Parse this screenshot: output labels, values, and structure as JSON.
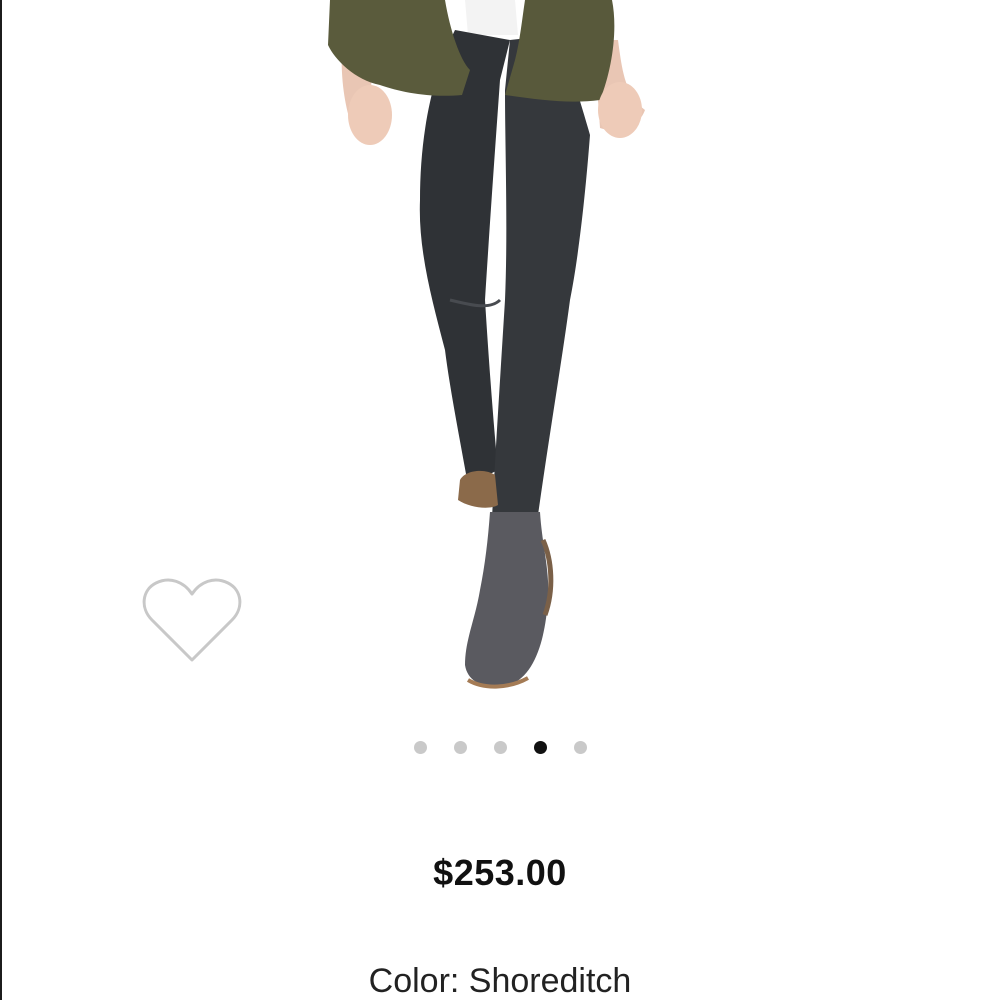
{
  "product": {
    "image_alt": "Model wearing dark coated skinny leggings, olive shirt and grey ankle boots",
    "price": "$253.00",
    "color_label": "Color:",
    "color_value": "Shoreditch"
  },
  "favorite": {
    "icon": "heart-outline-icon"
  },
  "carousel": {
    "total_slides": 5,
    "active_slide": 4
  },
  "colors": {
    "accent": "#111111",
    "dot_inactive": "#c9c9c9",
    "background": "#ffffff"
  }
}
